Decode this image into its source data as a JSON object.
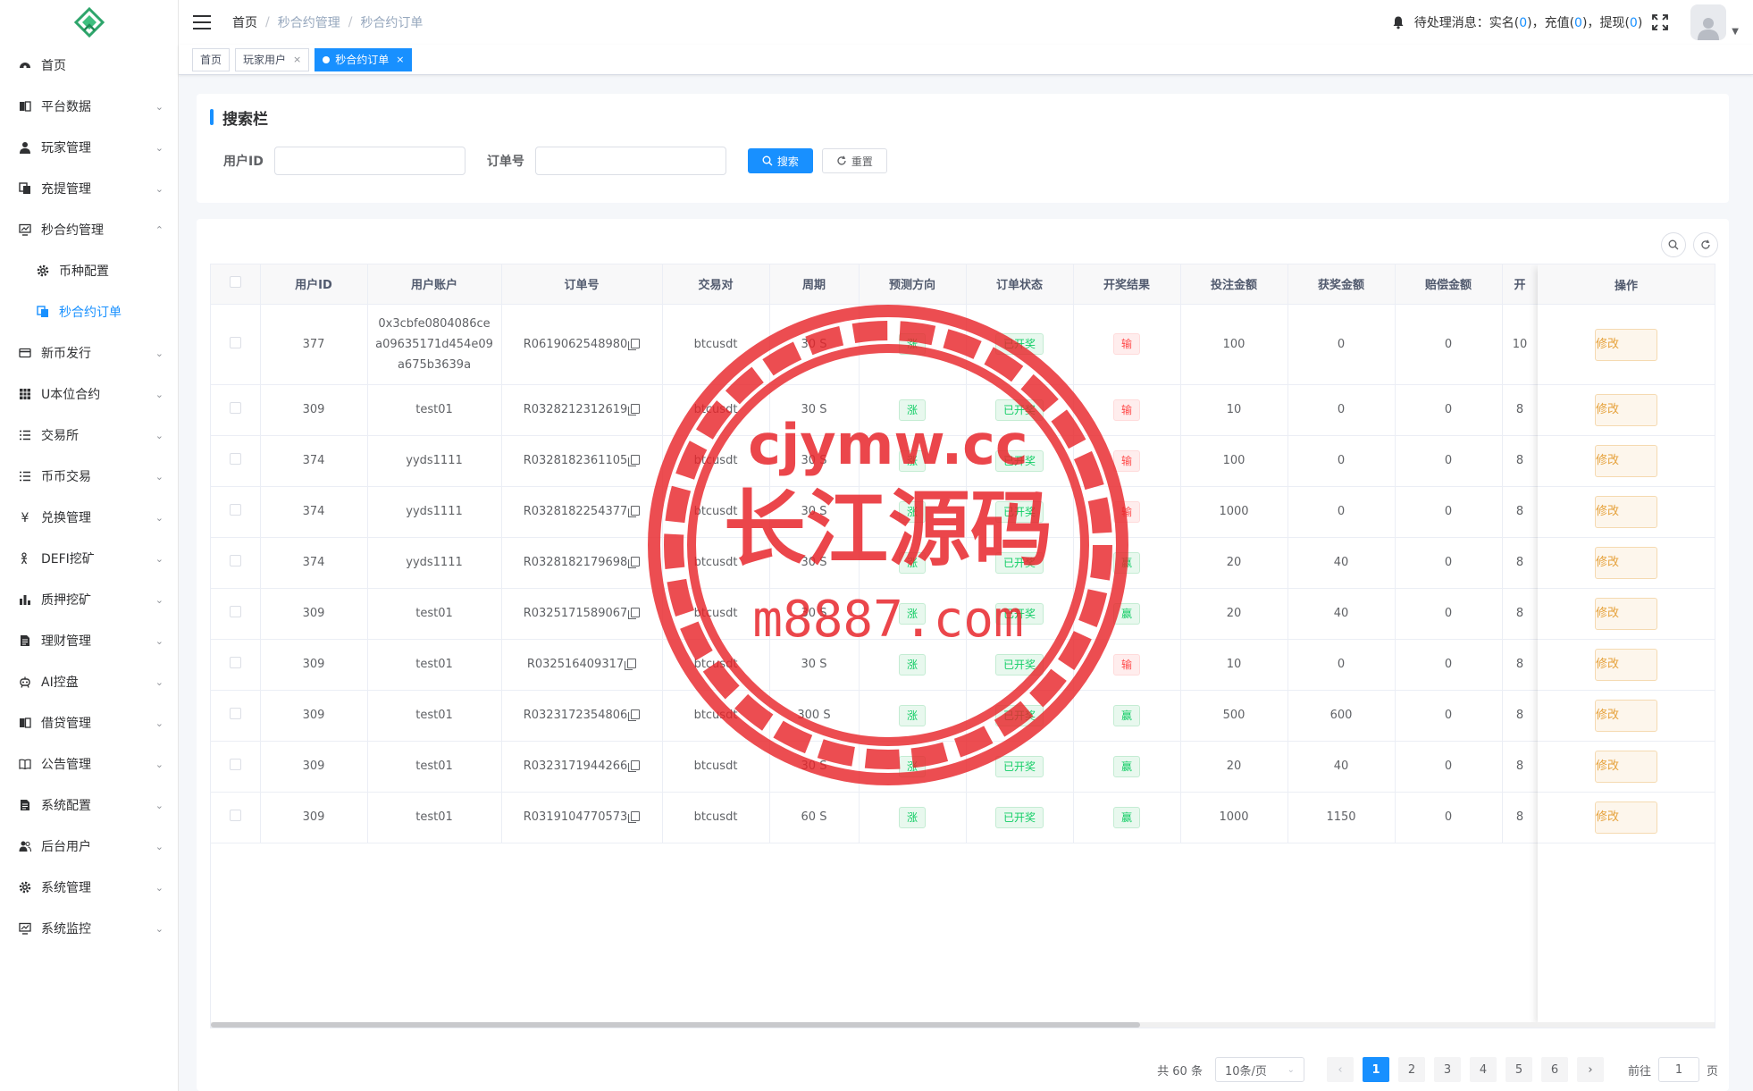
{
  "sidebar": {
    "items": [
      {
        "label": "首页",
        "icon": "dashboard-icon",
        "arrow": ""
      },
      {
        "label": "平台数据",
        "icon": "book-icon",
        "arrow": "⌄"
      },
      {
        "label": "玩家管理",
        "icon": "user-icon",
        "arrow": "⌄"
      },
      {
        "label": "充提管理",
        "icon": "copy-icon",
        "arrow": "⌄"
      },
      {
        "label": "秒合约管理",
        "icon": "monitor-icon",
        "arrow": "⌃"
      },
      {
        "label": "币种配置",
        "icon": "gear-icon",
        "arrow": "",
        "sub": true
      },
      {
        "label": "秒合约订单",
        "icon": "copy-icon",
        "arrow": "",
        "sub": true,
        "active": true
      },
      {
        "label": "新币发行",
        "icon": "card-icon",
        "arrow": "⌄"
      },
      {
        "label": "U本位合约",
        "icon": "grid-icon",
        "arrow": "⌄"
      },
      {
        "label": "交易所",
        "icon": "list-icon",
        "arrow": "⌄"
      },
      {
        "label": "币币交易",
        "icon": "list-icon",
        "arrow": "⌄"
      },
      {
        "label": "兑换管理",
        "icon": "yen-icon",
        "arrow": "⌄"
      },
      {
        "label": "DEFI挖矿",
        "icon": "person-icon",
        "arrow": "⌄"
      },
      {
        "label": "质押挖矿",
        "icon": "bar-chart-icon",
        "arrow": "⌄"
      },
      {
        "label": "理财管理",
        "icon": "document-icon",
        "arrow": "⌄"
      },
      {
        "label": "AI控盘",
        "icon": "robot-icon",
        "arrow": "⌄"
      },
      {
        "label": "借贷管理",
        "icon": "book-icon",
        "arrow": "⌄"
      },
      {
        "label": "公告管理",
        "icon": "open-book-icon",
        "arrow": "⌄"
      },
      {
        "label": "系统配置",
        "icon": "document-icon",
        "arrow": "⌄"
      },
      {
        "label": "后台用户",
        "icon": "users-icon",
        "arrow": "⌄"
      },
      {
        "label": "系统管理",
        "icon": "gear-icon",
        "arrow": "⌄"
      },
      {
        "label": "系统监控",
        "icon": "monitor-icon",
        "arrow": "⌄"
      }
    ]
  },
  "header": {
    "breadcrumb": [
      "首页",
      "秒合约管理",
      "秒合约订单"
    ],
    "notice": {
      "prefix": "待处理消息：",
      "items": [
        {
          "label": "实名",
          "count": "0"
        },
        {
          "label": "充值",
          "count": "0"
        },
        {
          "label": "提现",
          "count": "0"
        }
      ]
    }
  },
  "tags": [
    {
      "label": "首页",
      "closable": false,
      "active": false
    },
    {
      "label": "玩家用户",
      "closable": true,
      "active": false
    },
    {
      "label": "秒合约订单",
      "closable": true,
      "active": true
    }
  ],
  "search": {
    "title": "搜索栏",
    "fields": [
      {
        "label": "用户ID",
        "value": ""
      },
      {
        "label": "订单号",
        "value": ""
      }
    ],
    "search_btn": "搜索",
    "reset_btn": "重置"
  },
  "table": {
    "columns": [
      "",
      "用户ID",
      "用户账户",
      "订单号",
      "交易对",
      "周期",
      "预测方向",
      "订单状态",
      "开奖结果",
      "投注金额",
      "获奖金额",
      "赔偿金额",
      "开",
      "操作"
    ],
    "edit_label": "修改",
    "rows": [
      {
        "uid": "377",
        "account": "0x3cbfe0804086cea09635171d454e09a675b3639a",
        "order": "R0619062548980",
        "pair": "btcusdt",
        "period": "30 S",
        "direction": "涨",
        "status": "已开奖",
        "result": "输",
        "bet": "100",
        "win": "0",
        "comp": "0",
        "extra": "10"
      },
      {
        "uid": "309",
        "account": "test01",
        "order": "R0328212312619",
        "pair": "btcusdt",
        "period": "30 S",
        "direction": "涨",
        "status": "已开奖",
        "result": "输",
        "bet": "10",
        "win": "0",
        "comp": "0",
        "extra": "8"
      },
      {
        "uid": "374",
        "account": "yyds1111",
        "order": "R0328182361105",
        "pair": "btcusdt",
        "period": "30 S",
        "direction": "涨",
        "status": "已开奖",
        "result": "输",
        "bet": "100",
        "win": "0",
        "comp": "0",
        "extra": "8"
      },
      {
        "uid": "374",
        "account": "yyds1111",
        "order": "R0328182254377",
        "pair": "btcusdt",
        "period": "30 S",
        "direction": "涨",
        "status": "已开奖",
        "result": "输",
        "bet": "1000",
        "win": "0",
        "comp": "0",
        "extra": "8"
      },
      {
        "uid": "374",
        "account": "yyds1111",
        "order": "R0328182179698",
        "pair": "btcusdt",
        "period": "30 S",
        "direction": "涨",
        "status": "已开奖",
        "result": "赢",
        "bet": "20",
        "win": "40",
        "comp": "0",
        "extra": "8"
      },
      {
        "uid": "309",
        "account": "test01",
        "order": "R0325171589067",
        "pair": "btcusdt",
        "period": "30 S",
        "direction": "涨",
        "status": "已开奖",
        "result": "赢",
        "bet": "20",
        "win": "40",
        "comp": "0",
        "extra": "8"
      },
      {
        "uid": "309",
        "account": "test01",
        "order": "R032516409317",
        "pair": "btcusdt",
        "period": "30 S",
        "direction": "涨",
        "status": "已开奖",
        "result": "输",
        "bet": "10",
        "win": "0",
        "comp": "0",
        "extra": "8"
      },
      {
        "uid": "309",
        "account": "test01",
        "order": "R0323172354806",
        "pair": "btcusdt",
        "period": "300 S",
        "direction": "涨",
        "status": "已开奖",
        "result": "赢",
        "bet": "500",
        "win": "600",
        "comp": "0",
        "extra": "8"
      },
      {
        "uid": "309",
        "account": "test01",
        "order": "R0323171944266",
        "pair": "btcusdt",
        "period": "30 S",
        "direction": "涨",
        "status": "已开奖",
        "result": "赢",
        "bet": "20",
        "win": "40",
        "comp": "0",
        "extra": "8"
      },
      {
        "uid": "309",
        "account": "test01",
        "order": "R0319104770573",
        "pair": "btcusdt",
        "period": "60 S",
        "direction": "涨",
        "status": "已开奖",
        "result": "赢",
        "bet": "1000",
        "win": "1150",
        "comp": "0",
        "extra": "8"
      }
    ]
  },
  "pagination": {
    "total": "共 60 条",
    "page_size": "10条/页",
    "pages": [
      "1",
      "2",
      "3",
      "4",
      "5",
      "6"
    ],
    "current": "1",
    "prev": "‹",
    "next": "›",
    "jump_prefix": "前往",
    "jump_value": "1",
    "jump_suffix": "页"
  },
  "watermark": {
    "line1": "cjymw.cc",
    "line2": "长江源码",
    "line3": "m8887.com",
    "color": "#e8262b"
  },
  "colors": {
    "primary": "#1890ff",
    "success": "#13ce66",
    "danger": "#ff4949",
    "warning": "#e6a23c"
  }
}
